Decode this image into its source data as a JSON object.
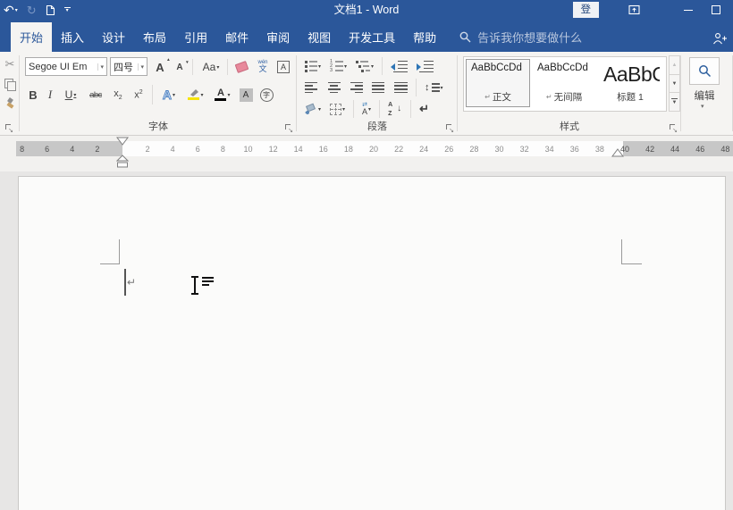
{
  "colors": {
    "titlebar_blue": "#2b579a",
    "active_tab_text": "#2b579a",
    "ribbon_bg": "#f5f4f2",
    "highlight_yellow": "#f6e40c",
    "font_color_bar": "#000000"
  },
  "titlebar": {
    "title": "文档1 - Word",
    "signin_label": "登录"
  },
  "tabs": {
    "search_placeholder": "告诉我你想要做什么",
    "items": [
      {
        "label": "开始",
        "active": true
      },
      {
        "label": "插入"
      },
      {
        "label": "设计"
      },
      {
        "label": "布局"
      },
      {
        "label": "引用"
      },
      {
        "label": "邮件"
      },
      {
        "label": "审阅"
      },
      {
        "label": "视图"
      },
      {
        "label": "开发工具"
      },
      {
        "label": "帮助"
      }
    ]
  },
  "ribbon": {
    "font": {
      "label": "字体",
      "font_name": "Segoe UI Em",
      "font_size": "四号"
    },
    "paragraph": {
      "label": "段落"
    },
    "styles": {
      "label": "样式",
      "gallery": [
        {
          "sample": "AaBbCcDd",
          "name": "正文",
          "selected": true
        },
        {
          "sample": "AaBbCcDd",
          "name": "无间隔"
        },
        {
          "sample": "AaBbCcDd",
          "name": "标题 1"
        }
      ]
    },
    "editing": {
      "label": "编辑"
    }
  },
  "glyphs": {
    "bold": "B",
    "italic": "I",
    "underline": "U",
    "strikethrough": "abc",
    "sub_base": "x",
    "sub_digit": "2",
    "sup_base": "x",
    "sup_digit": "2",
    "change_case": "Aa",
    "grow_font": "A",
    "shrink_font": "A",
    "text_effects": "A",
    "font_color": "A",
    "char_shading": "A",
    "char_border": "A",
    "enclose": "字",
    "phonetic_top": "wén",
    "phonetic_bottom": "文",
    "sort_a": "A",
    "sort_z": "Z",
    "sort_arrow": "↓",
    "pilcrow": "↵",
    "cut": "✂",
    "undo": "↶",
    "repeat": "↻",
    "updown": "↕",
    "swap": "⇄",
    "numbering": [
      "1",
      "2",
      "3"
    ]
  },
  "ruler": {
    "left_numbers": [
      8,
      6,
      4,
      2
    ],
    "main_numbers": [
      2,
      4,
      6,
      8,
      10,
      12,
      14,
      16,
      18,
      20,
      22,
      24,
      26,
      28,
      30,
      32,
      34,
      36,
      38
    ],
    "right_numbers": [
      40,
      42,
      44,
      46,
      48
    ]
  }
}
